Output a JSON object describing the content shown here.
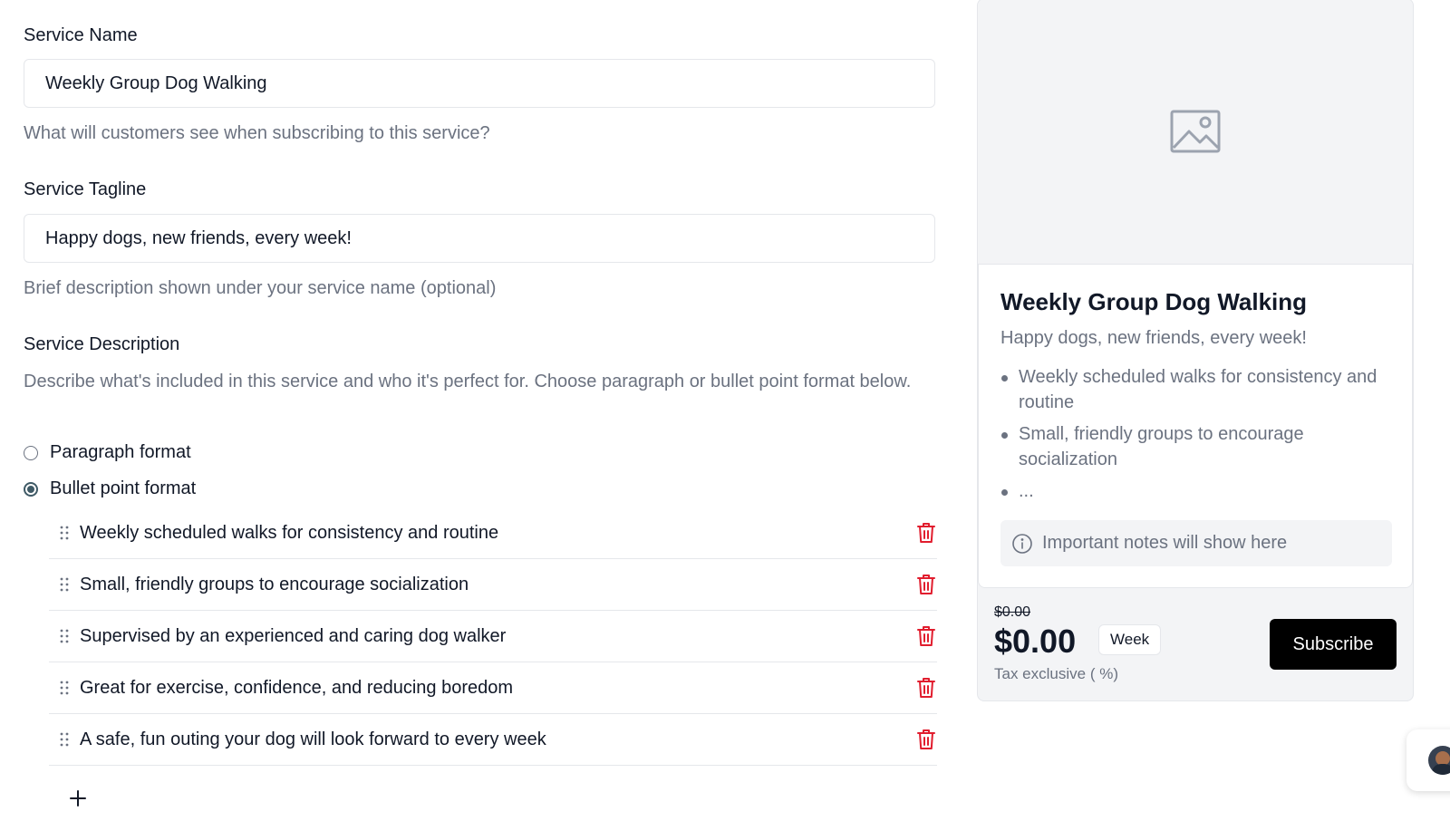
{
  "form": {
    "service_name_label": "Service Name",
    "service_name_value": "Weekly Group Dog Walking",
    "service_name_help": "What will customers see when subscribing to this service?",
    "tagline_label": "Service Tagline",
    "tagline_value": "Happy dogs, new friends, every week!",
    "tagline_help": "Brief description shown under your service name (optional)",
    "description_label": "Service Description",
    "description_help": "Describe what's included in this service and who it's perfect for. Choose paragraph or bullet point format below.",
    "format_options": [
      {
        "label": "Paragraph format",
        "selected": false
      },
      {
        "label": "Bullet point format",
        "selected": true
      }
    ],
    "bullets": [
      "Weekly scheduled walks for consistency and routine",
      "Small, friendly groups to encourage socialization",
      "Supervised by an experienced and caring dog walker",
      "Great for exercise, confidence, and reducing boredom",
      "A safe, fun outing your dog will look forward to every week"
    ],
    "add_icon": "plus-icon"
  },
  "preview": {
    "image_placeholder_icon": "image-icon",
    "title": "Weekly Group Dog Walking",
    "tagline": "Happy dogs, new friends, every week!",
    "bullets": [
      "Weekly scheduled walks for consistency and routine",
      "Small, friendly groups to encourage socialization",
      "..."
    ],
    "note": "Important notes will show here",
    "old_price": "$0.00",
    "price": "$0.00",
    "period": "Week",
    "tax": "Tax exclusive ( %)",
    "subscribe_label": "Subscribe"
  },
  "colors": {
    "danger": "#e11d2e",
    "radio_selected": "#3f5a66",
    "subscribe_bg": "#000000"
  }
}
